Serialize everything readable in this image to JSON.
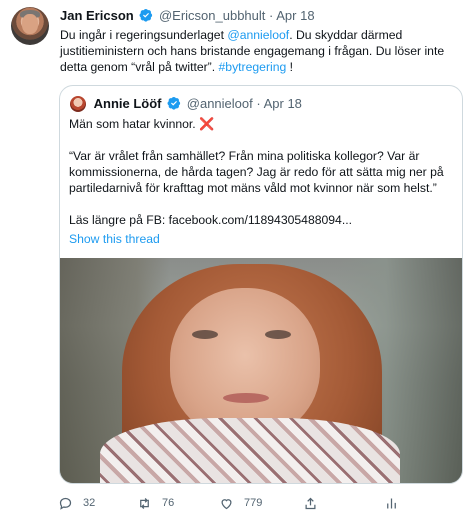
{
  "tweet": {
    "author_name": "Jan Ericson",
    "author_handle": "@Ericson_ubbhult",
    "separator": "·",
    "time": "Apr 18",
    "text_1": "Du ingår i regeringsunderlaget ",
    "mention": "@annieloof",
    "text_2": ". Du skyddar därmed justitieministern och hans bristande engagemang i frågan. Du löser inte detta genom “vrål på twitter”. ",
    "hashtag": "#bytregering",
    "text_3": " !"
  },
  "quote": {
    "author_name": "Annie Lööf",
    "author_handle": "@annieloof",
    "separator": "·",
    "time": "Apr 18",
    "line_1": "Män som hatar kvinnor. ",
    "cross": "❌",
    "line_2": "“Var är vrålet från samhället? Från mina politiska kollegor? Var är kommissionerna, de hårda tagen? Jag är redo för att sätta mig ner på partiledarnivå för krafttag mot mäns våld mot kvinnor när som helst.”",
    "line_3": "Läs längre på FB: facebook.com/11894305488094...",
    "show_thread": "Show this thread"
  },
  "actions": {
    "reply_count": "32",
    "retweet_count": "76",
    "like_count": "779"
  },
  "colors": {
    "link": "#1d9bf0",
    "secondary_text": "#536471",
    "border": "#cfd9de"
  },
  "icons": [
    "verified-badge-icon",
    "reply-icon",
    "retweet-icon",
    "like-icon",
    "share-icon",
    "analytics-icon"
  ]
}
